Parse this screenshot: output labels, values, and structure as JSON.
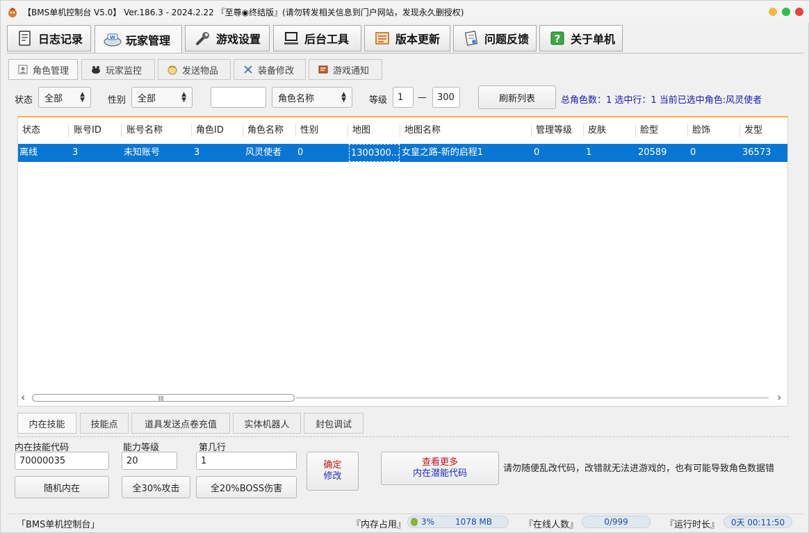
{
  "window": {
    "title": "【BMS单机控制台 V5.0】 Ver.186.3 - 2024.2.22 『至尊◉终结版』(请勿转发相关信息到门户网站，发现永久删授权)",
    "colors": {
      "min": "#f5b942",
      "max": "#2fbf4a",
      "close": "#e8443a"
    }
  },
  "main_tabs": [
    {
      "label": "日志记录",
      "icon": "notebook-icon"
    },
    {
      "label": "玩家管理",
      "icon": "keyboard-icon"
    },
    {
      "label": "游戏设置",
      "icon": "wrench-icon"
    },
    {
      "label": "后台工具",
      "icon": "computer-icon"
    },
    {
      "label": "版本更新",
      "icon": "scroll-icon"
    },
    {
      "label": "问题反馈",
      "icon": "feedback-icon"
    },
    {
      "label": "关于单机",
      "icon": "help-icon"
    }
  ],
  "sub_tabs": [
    {
      "label": "角色管理",
      "icon": "character-icon"
    },
    {
      "label": "玩家监控",
      "icon": "monitor-icon"
    },
    {
      "label": "发送物品",
      "icon": "gift-icon"
    },
    {
      "label": "装备修改",
      "icon": "equipment-icon"
    },
    {
      "label": "游戏通知",
      "icon": "notice-icon"
    }
  ],
  "filters": {
    "status_label": "状态",
    "status_value": "全部",
    "gender_label": "性别",
    "gender_value": "全部",
    "search_value": "",
    "search_type": "角色名称",
    "level_label": "等级",
    "level_min": "1",
    "level_dash": "—",
    "level_max": "300",
    "refresh_label": "刷新列表",
    "info": "总角色数：1  选中行：1  当前已选中角色:风灵使者"
  },
  "grid": {
    "columns": [
      "状态",
      "账号ID",
      "账号名称",
      "角色ID",
      "角色名称",
      "性别",
      "地图",
      "地图名称",
      "管理等级",
      "皮肤",
      "脸型",
      "脸饰",
      "发型"
    ],
    "rows": [
      [
        "离线",
        "3",
        "未知账号",
        "3",
        "风灵使者",
        "0",
        "1300300...",
        "女皇之路-新的启程1",
        "0",
        "1",
        "20589",
        "0",
        "36573"
      ]
    ],
    "scroll_left": "‹",
    "scroll_right": "›"
  },
  "bottom_tabs": [
    "内在技能",
    "技能点",
    "道具发送点卷充值",
    "实体机器人",
    "封包调试"
  ],
  "skill_form": {
    "code_label": "内在技能代码",
    "code_value": "70000035",
    "level_label": "能力等级",
    "level_value": "20",
    "row_label": "第几行",
    "row_value": "1",
    "confirm_line1": "确定",
    "confirm_line2": "修改",
    "random_label": "随机内在",
    "attack_label": "全30%攻击",
    "boss_label": "全20%BOSS伤害",
    "more_line1": "查看更多",
    "more_line2": "内在潜能代码",
    "warning": "请勿随便乱改代码，改错就无法进游戏的，也有可能导致角色数据错"
  },
  "statusbar": {
    "app_name": "「BMS单机控制台」",
    "memory_label": "『内存占用』",
    "memory_percent": "3%",
    "memory_value": "1078 MB",
    "memory_fraction": 0.03,
    "online_label": "『在线人数』",
    "online_value": "0/999",
    "uptime_label": "『运行时长』",
    "uptime_value": "0天 00:11:50"
  }
}
